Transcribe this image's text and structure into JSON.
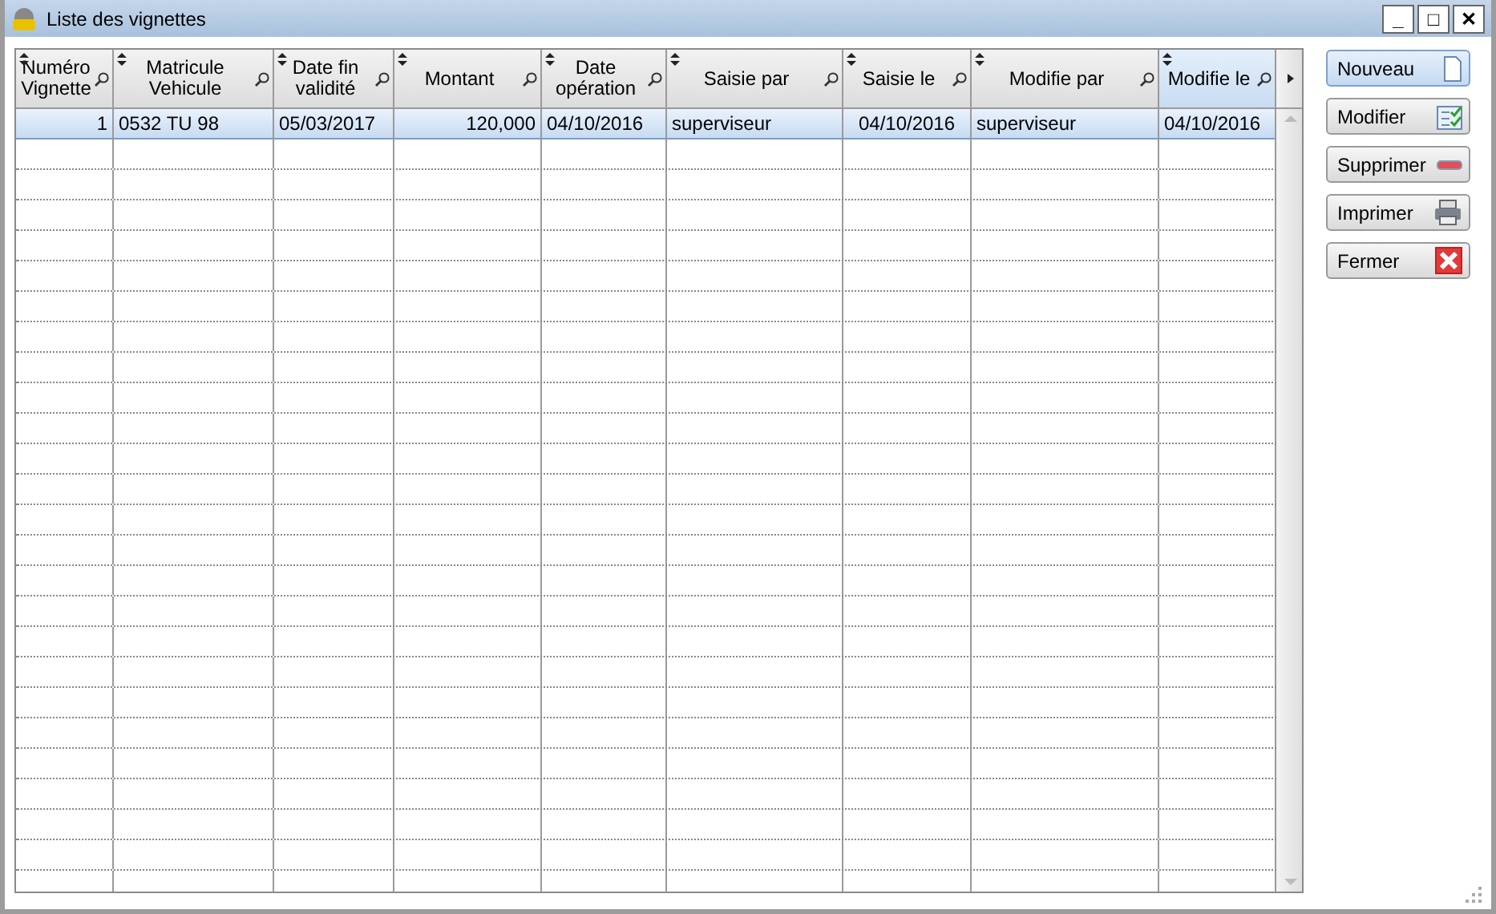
{
  "window": {
    "title": "Liste des vignettes",
    "controls": [
      "_",
      "□",
      "✕"
    ]
  },
  "table": {
    "columns": [
      {
        "label": "Numéro Vignette",
        "kind": "number",
        "selected": false
      },
      {
        "label": "Matricule Vehicule",
        "kind": "text",
        "selected": false
      },
      {
        "label": "Date fin validité",
        "kind": "text",
        "selected": false
      },
      {
        "label": "Montant",
        "kind": "number",
        "selected": false
      },
      {
        "label": "Date opération",
        "kind": "text",
        "selected": false
      },
      {
        "label": "Saisie par",
        "kind": "text",
        "selected": false
      },
      {
        "label": "Saisie le",
        "kind": "centered",
        "selected": false
      },
      {
        "label": "Modifie par",
        "kind": "text",
        "selected": false
      },
      {
        "label": "Modifie le",
        "kind": "text",
        "selected": true
      }
    ],
    "rows": [
      {
        "selected": true,
        "cells": [
          "1",
          "0532 TU 98",
          "05/03/2017",
          "120,000",
          "04/10/2016",
          "superviseur",
          "04/10/2016",
          "superviseur",
          "04/10/2016"
        ]
      }
    ]
  },
  "buttons": [
    {
      "label": "Nouveau",
      "kind": "new",
      "default": true
    },
    {
      "label": "Modifier",
      "kind": "edit",
      "default": false
    },
    {
      "label": "Supprimer",
      "kind": "delete",
      "default": false
    },
    {
      "label": "Imprimer",
      "kind": "print",
      "default": false
    },
    {
      "label": "Fermer",
      "kind": "close",
      "default": false
    }
  ]
}
